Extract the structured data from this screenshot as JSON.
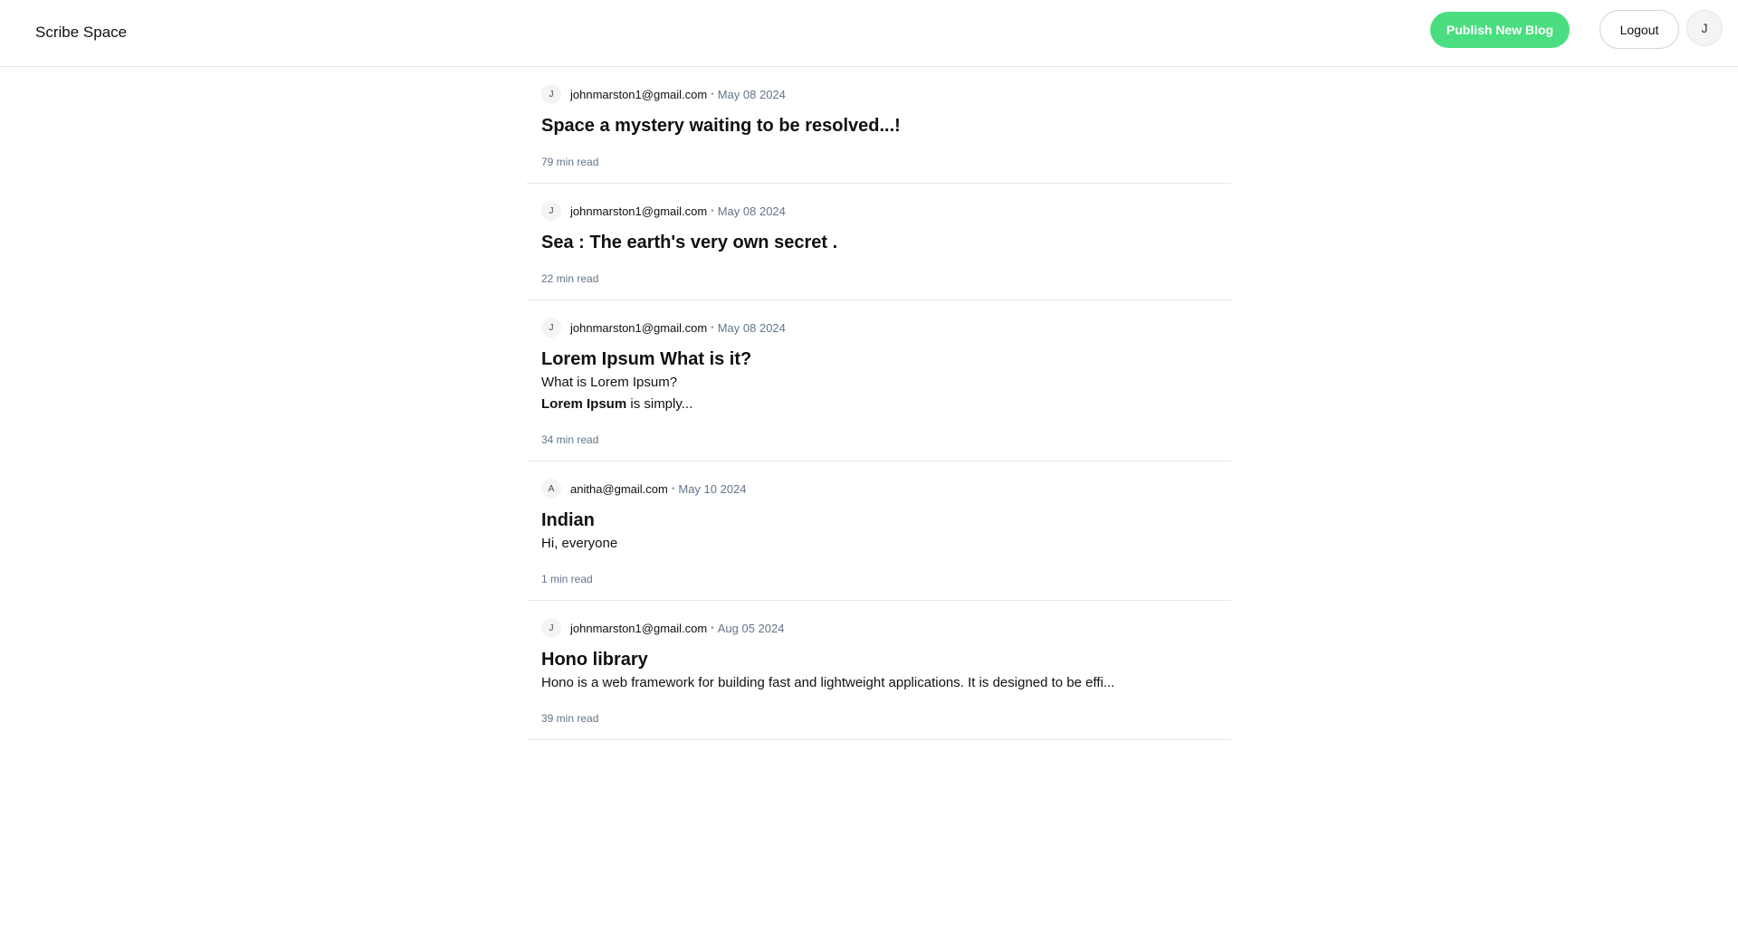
{
  "header": {
    "brand": "Scribe Space",
    "publish_label": "Publish New Blog",
    "logout_label": "Logout",
    "avatar_initial": "J"
  },
  "posts": [
    {
      "initial": "J",
      "author": "johnmarston1@gmail.com",
      "separator": "•",
      "date": "May 08 2024",
      "title": "Space a mystery waiting to be resolved...!",
      "read_time": "79 min read"
    },
    {
      "initial": "J",
      "author": "johnmarston1@gmail.com",
      "separator": "•",
      "date": "May 08 2024",
      "title": "Sea : The earth's very own secret .",
      "read_time": "22 min read"
    },
    {
      "initial": "J",
      "author": "johnmarston1@gmail.com",
      "separator": "•",
      "date": "May 08 2024",
      "title": "Lorem Ipsum What is it?",
      "excerpt_line1": "What is Lorem Ipsum?",
      "excerpt_bold": "Lorem Ipsum",
      "excerpt_rest": " is simply...",
      "read_time": "34 min read"
    },
    {
      "initial": "A",
      "author": "anitha@gmail.com",
      "separator": "•",
      "date": "May 10 2024",
      "title": "Indian",
      "excerpt": "Hi, everyone",
      "read_time": "1 min read"
    },
    {
      "initial": "J",
      "author": "johnmarston1@gmail.com",
      "separator": "•",
      "date": "Aug 05 2024",
      "title": "Hono library",
      "excerpt": "Hono is a web framework for building fast and lightweight applications. It is designed to be effi...",
      "read_time": "39 min read"
    }
  ]
}
